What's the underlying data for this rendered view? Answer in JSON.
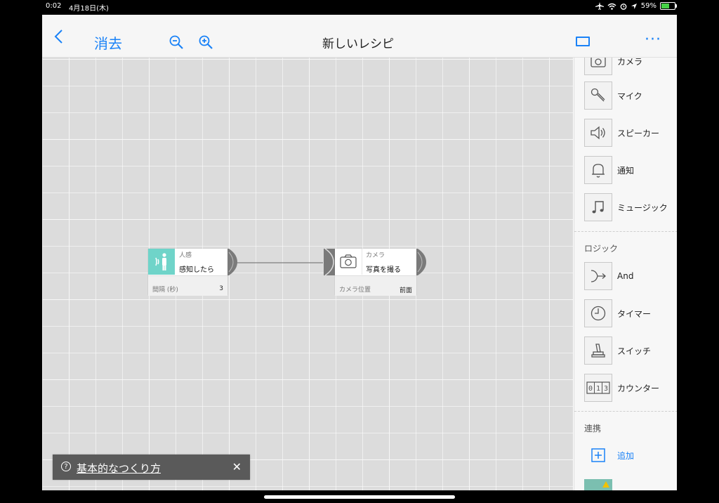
{
  "status_bar": {
    "time": "0:02",
    "date": "4月18日(木)",
    "battery": "59%",
    "battery_level": 0.59
  },
  "nav": {
    "delete_label": "消去",
    "title": "新しいレシピ",
    "more_label": "···"
  },
  "canvas": {
    "blocks": [
      {
        "category": "人感",
        "action": "感知したら",
        "param_label": "間隔 (秒)",
        "param_value": "3",
        "icon": "motion-sensor-icon",
        "icon_color": "#6fd4c9"
      },
      {
        "category": "カメラ",
        "action": "写真を撮る",
        "param_label": "カメラ位置",
        "param_value": "前面",
        "icon": "camera-icon"
      }
    ]
  },
  "sidebar": {
    "items_top": [
      {
        "label": "カメラ",
        "icon": "camera-icon"
      },
      {
        "label": "マイク",
        "icon": "microphone-icon"
      },
      {
        "label": "スピーカー",
        "icon": "speaker-icon"
      },
      {
        "label": "通知",
        "icon": "bell-icon"
      },
      {
        "label": "ミュージック",
        "icon": "music-note-icon"
      }
    ],
    "logic_header": "ロジック",
    "logic_items": [
      {
        "label": "And",
        "icon": "and-merge-icon"
      },
      {
        "label": "タイマー",
        "icon": "timer-icon"
      },
      {
        "label": "スイッチ",
        "icon": "switch-icon"
      },
      {
        "label": "カウンター",
        "icon": "counter-icon"
      }
    ],
    "integration_header": "連携",
    "add_label": "追加"
  },
  "help_bar": {
    "link_text": "基本的なつくり方",
    "help_icon": "?",
    "close": "✕"
  },
  "colors": {
    "accent": "#1a82f7",
    "sensor": "#6fd4c9"
  }
}
